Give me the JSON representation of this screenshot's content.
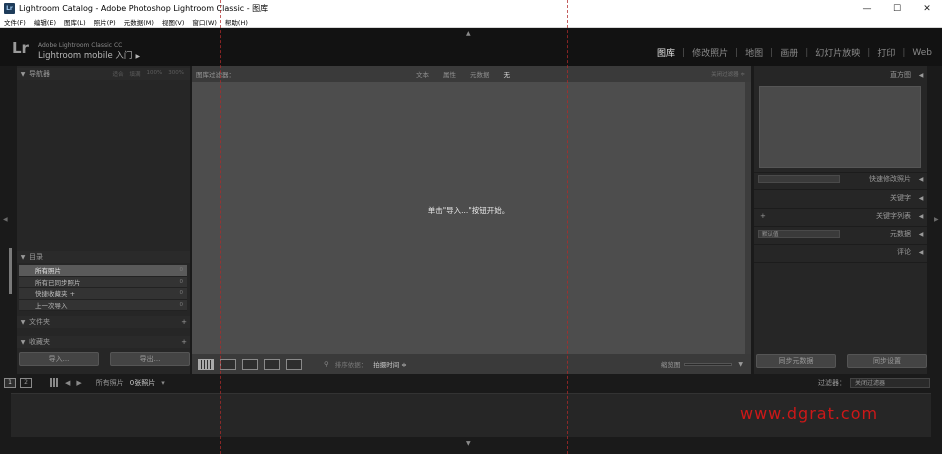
{
  "window": {
    "title": "Lightroom Catalog - Adobe Photoshop Lightroom Classic - 图库",
    "controls": [
      "—",
      "☐",
      "✕"
    ]
  },
  "menubar": [
    "文件(F)",
    "编辑(E)",
    "图库(L)",
    "照片(P)",
    "元数据(M)",
    "视图(V)",
    "窗口(W)",
    "帮助(H)"
  ],
  "identity": {
    "logo": "Lr",
    "line1": "Adobe Lightroom Classic CC",
    "line2": "Lightroom mobile 入门",
    "line2_arrow": "▶"
  },
  "modules": [
    {
      "label": "图库",
      "active": true
    },
    {
      "label": "修改照片",
      "active": false
    },
    {
      "label": "地图",
      "active": false
    },
    {
      "label": "画册",
      "active": false
    },
    {
      "label": "幻灯片放映",
      "active": false
    },
    {
      "label": "打印",
      "active": false
    },
    {
      "label": "Web",
      "active": false
    }
  ],
  "left_panel": {
    "navigator": {
      "label": "导航器",
      "options": [
        "适合",
        "填满",
        "100%",
        "300%"
      ]
    },
    "catalog": {
      "label": "目录",
      "items": [
        {
          "name": "所有照片",
          "count": "0"
        },
        {
          "name": "所有已同步照片",
          "count": "0"
        },
        {
          "name": "快捷收藏夹 +",
          "count": "0"
        },
        {
          "name": "上一次导入",
          "count": "0"
        }
      ]
    },
    "folders": {
      "label": "文件夹"
    },
    "collections": {
      "label": "收藏夹"
    },
    "import_button": "导入...",
    "export_button": "导出..."
  },
  "center": {
    "filter_label": "图库过滤器：",
    "filter_tabs": [
      {
        "label": "文本",
        "on": false
      },
      {
        "label": "属性",
        "on": false
      },
      {
        "label": "元数据",
        "on": false
      },
      {
        "label": "无",
        "on": true
      }
    ],
    "filter_preset": "关闭过滤器 ≑",
    "empty_message": "单击\"导入...\"按钮开始。",
    "toolbar": {
      "sort_label": "排序依据：",
      "sort_value": "拍摄时间 ≑",
      "thumbnails_label": "缩览图",
      "thumb_dropdown": "▼"
    }
  },
  "right_panel": {
    "histogram": "直方图",
    "quick_develop": "快速修改照片",
    "keywording": "关键字",
    "keyword_list": "关键字列表",
    "metadata": "元数据",
    "metadata_preset": "默认值",
    "comments": "评论",
    "sync_metadata": "同步元数据",
    "sync_settings": "同步设置"
  },
  "filmstrip": {
    "pages": [
      "1",
      "2"
    ],
    "source": "所有照片",
    "count": "0张照片",
    "count_arrow": "▾",
    "filter_label": "过滤器：",
    "filter_value": "关闭过滤器"
  },
  "watermark": "www.dgrat.com",
  "colors": {
    "background": "#1a1a1a",
    "panel": "#262626",
    "center": "#4d4d4d",
    "active_module": "#e6e6e6",
    "watermark": "#cc1818"
  }
}
